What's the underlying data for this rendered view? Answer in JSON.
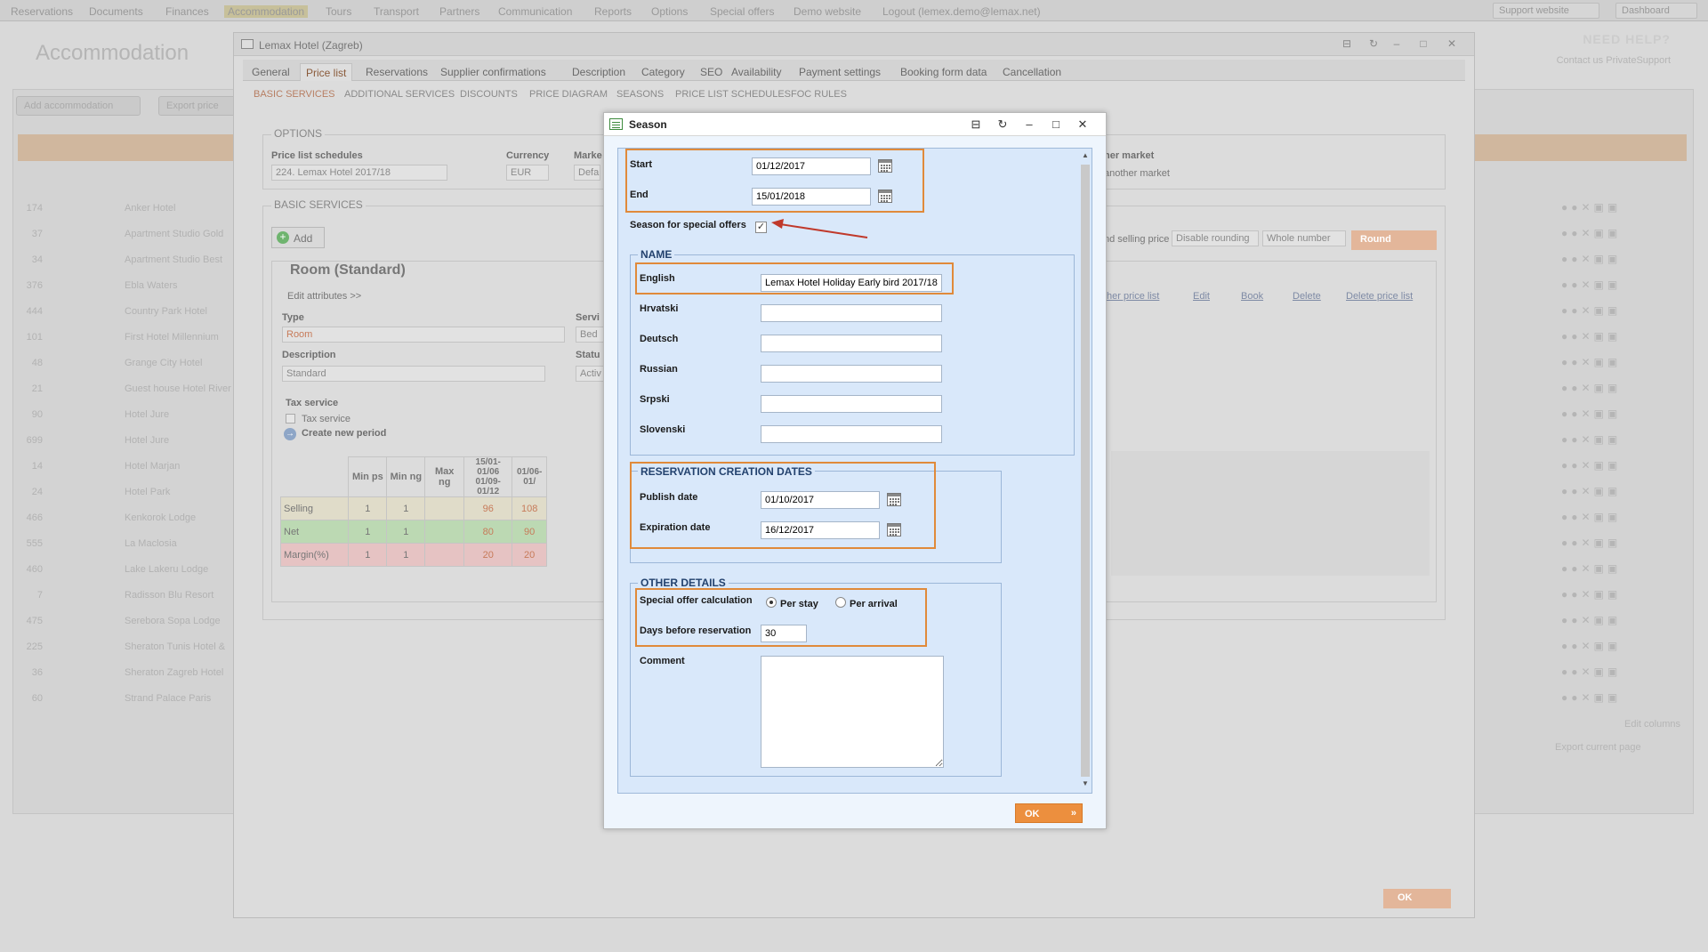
{
  "topnav": {
    "items": [
      "Reservations",
      "Documents",
      "Finances",
      "Accommodation",
      "Tours",
      "Transport",
      "Partners",
      "Communication",
      "Reports",
      "Options",
      "Special offers",
      "Demo website",
      "Logout (lemex.demo@lemax.net)"
    ],
    "support_label": "Support website",
    "dashboard_label": "Dashboard"
  },
  "background": {
    "page_title": "Accommodation",
    "need_help": "NEED HELP?",
    "need_help_sub": "Contact us PrivateSupport",
    "add_button": "Add accommodation",
    "export_button": "Export price",
    "rows": [
      {
        "id": "174",
        "name": "Anker Hotel"
      },
      {
        "id": "37",
        "name": "Apartment Studio Gold"
      },
      {
        "id": "34",
        "name": "Apartment Studio Best"
      },
      {
        "id": "376",
        "name": "Ebla Waters"
      },
      {
        "id": "444",
        "name": "Country Park Hotel"
      },
      {
        "id": "101",
        "name": "First Hotel Millennium"
      },
      {
        "id": "48",
        "name": "Grange City Hotel"
      },
      {
        "id": "21",
        "name": "Guest house Hotel River"
      },
      {
        "id": "90",
        "name": "Hotel Jure"
      },
      {
        "id": "699",
        "name": "Hotel Jure"
      },
      {
        "id": "14",
        "name": "Hotel Marjan"
      },
      {
        "id": "24",
        "name": "Hotel Park"
      },
      {
        "id": "466",
        "name": "Kenkorok Lodge"
      },
      {
        "id": "555",
        "name": "La Maclosia"
      },
      {
        "id": "460",
        "name": "Lake Lakeru Lodge"
      },
      {
        "id": "7",
        "name": "Radisson Blu Resort"
      },
      {
        "id": "475",
        "name": "Serebora Sopa Lodge"
      },
      {
        "id": "225",
        "name": "Sheraton Tunis Hotel &"
      },
      {
        "id": "36",
        "name": "Sheraton Zagreb Hotel"
      },
      {
        "id": "60",
        "name": "Strand Palace Paris"
      }
    ],
    "export_current": "Export current page",
    "edit_columns": "Edit columns"
  },
  "hotel_window": {
    "title": "Lemax Hotel (Zagreb)",
    "tabs": [
      "General",
      "Price list",
      "Reservations",
      "Supplier confirmations",
      "Description",
      "Category",
      "SEO",
      "Availability",
      "Payment settings",
      "Booking form data",
      "Cancellation"
    ],
    "active_tab": "Price list",
    "subtabs": [
      "BASIC SERVICES",
      "ADDITIONAL SERVICES",
      "DISCOUNTS",
      "PRICE DIAGRAM",
      "SEASONS",
      "PRICE LIST SCHEDULES",
      "FOC RULES"
    ],
    "options_legend": "OPTIONS",
    "price_list_schedules_label": "Price list schedules",
    "price_list_schedule_value": "224. Lemax Hotel 2017/18",
    "currency_label": "Currency",
    "currency_value": "EUR",
    "market_label": "Marke",
    "market_value": "Defa",
    "other_market_label": "her market",
    "other_market_value": "another market",
    "basic_services_legend": "BASIC SERVICES",
    "add_label": "Add",
    "room_title": "Room (Standard)",
    "edit_attributes": "Edit attributes >>",
    "type_label": "Type",
    "type_value": "Room",
    "service_label": "Servi",
    "service_value": "Bed",
    "description_label": "Description",
    "description_value": "Standard",
    "status_label": "Statu",
    "status_value": "Activ",
    "tax_service_heading": "Tax service",
    "tax_service_label": "Tax service",
    "create_new_period": "Create new period",
    "selling_price_label": "nd selling price",
    "disable_rounding": "Disable rounding",
    "whole_number": "Whole number",
    "round_label": "Round",
    "links": {
      "other_price_list": "ther price list",
      "edit": "Edit",
      "book": "Book",
      "delete": "Delete",
      "delete_price_list": "Delete price list"
    },
    "table": {
      "headers": [
        "Min ps",
        "Min ng",
        "Max ng",
        "15/01-01/06 01/09-01/12",
        "01/06-01/"
      ],
      "rows": [
        {
          "label": "Selling",
          "values": [
            "1",
            "1",
            "",
            "96",
            "108"
          ]
        },
        {
          "label": "Net",
          "values": [
            "1",
            "1",
            "",
            "80",
            "90"
          ]
        },
        {
          "label": "Margin(%)",
          "values": [
            "1",
            "1",
            "",
            "20",
            "20"
          ]
        }
      ]
    },
    "ok_label": "OK"
  },
  "season_dialog": {
    "title": "Season",
    "start_label": "Start",
    "start_value": "01/12/2017",
    "end_label": "End",
    "end_value": "15/01/2018",
    "special_offers_label": "Season for special offers",
    "special_offers_checked": true,
    "name_legend": "NAME",
    "languages": [
      {
        "label": "English",
        "value": "Lemax Hotel Holiday Early bird 2017/18"
      },
      {
        "label": "Hrvatski",
        "value": ""
      },
      {
        "label": "Deutsch",
        "value": ""
      },
      {
        "label": "Russian",
        "value": ""
      },
      {
        "label": "Srpski",
        "value": ""
      },
      {
        "label": "Slovenski",
        "value": ""
      }
    ],
    "reservation_legend": "RESERVATION CREATION DATES",
    "publish_label": "Publish date",
    "publish_value": "01/10/2017",
    "expiration_label": "Expiration date",
    "expiration_value": "16/12/2017",
    "other_legend": "OTHER DETAILS",
    "calc_label": "Special offer calculation",
    "per_stay": "Per stay",
    "per_arrival": "Per arrival",
    "calc_selected": "Per stay",
    "days_label": "Days before reservation",
    "days_value": "30",
    "comment_label": "Comment",
    "comment_value": "",
    "ok_label": "OK",
    "highlight_color": "#e08a3a",
    "arrow_color": "#c0392b"
  }
}
